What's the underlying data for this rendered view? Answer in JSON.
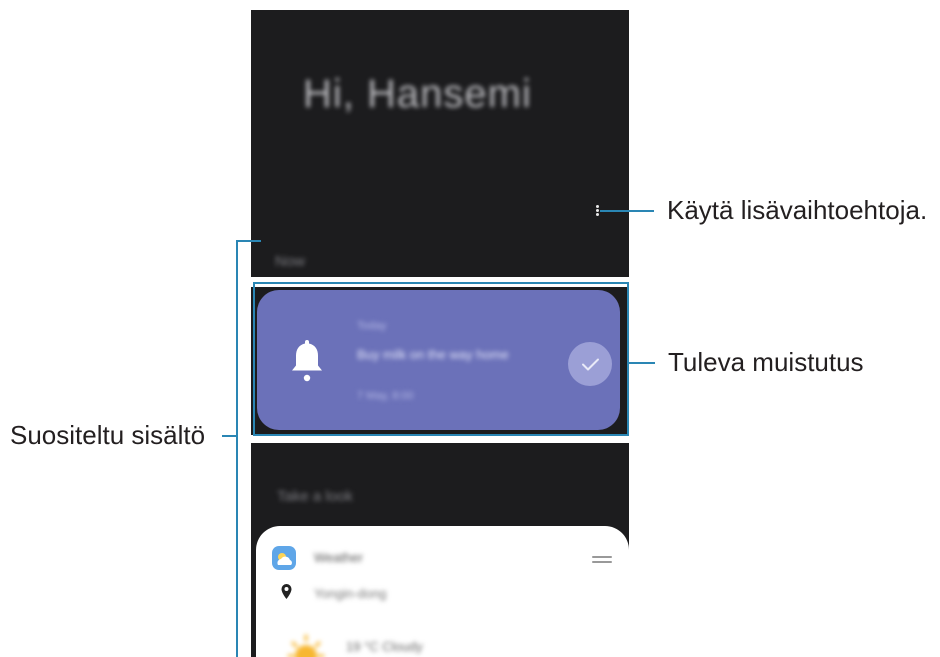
{
  "screen": {
    "greeting": "Hi, Hansemi",
    "section_now": "Now",
    "section_later": "Take a look",
    "reminder": {
      "time": "Today",
      "title": "Buy milk on the way home",
      "subtitle": "7 May, 8:00"
    },
    "weather": {
      "app_label": "Weather",
      "location": "Yongin-dong",
      "temperature": "19 °C Cloudy"
    }
  },
  "callouts": {
    "more_options": "Käytä lisävaihtoehtoja.",
    "upcoming_reminder": "Tuleva muistutus",
    "recommended_content": "Suositeltu sisältö"
  },
  "colors": {
    "accent_line": "#2a86b4",
    "phone_bg": "#1c1c1e",
    "reminder_card": "#6b71b9"
  }
}
